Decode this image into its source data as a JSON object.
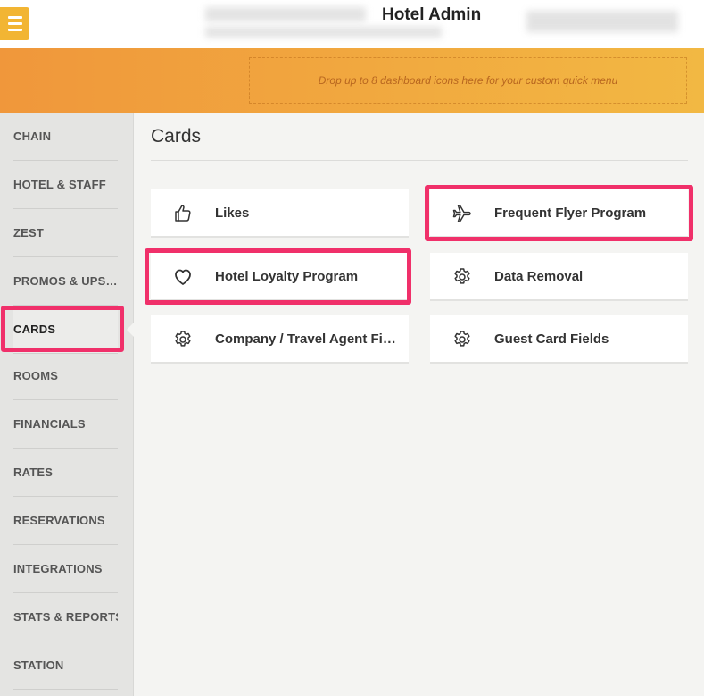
{
  "header": {
    "title": "Hotel Admin",
    "menu_icon": "hamburger-icon"
  },
  "quick_menu": {
    "placeholder": "Drop up to 8 dashboard icons here for your custom quick menu"
  },
  "sidebar": {
    "items": [
      {
        "label": "CHAIN"
      },
      {
        "label": "HOTEL & STAFF"
      },
      {
        "label": "ZEST"
      },
      {
        "label": "PROMOS & UPS…"
      },
      {
        "label": "CARDS",
        "active": true
      },
      {
        "label": "ROOMS"
      },
      {
        "label": "FINANCIALS"
      },
      {
        "label": "RATES"
      },
      {
        "label": "RESERVATIONS"
      },
      {
        "label": "INTEGRATIONS"
      },
      {
        "label": "STATS & REPORTS"
      },
      {
        "label": "STATION"
      }
    ]
  },
  "main": {
    "title": "Cards",
    "cards": [
      {
        "label": "Likes",
        "icon": "thumbs-up-icon"
      },
      {
        "label": "Frequent Flyer Program",
        "icon": "airplane-icon",
        "highlighted": true
      },
      {
        "label": "Hotel Loyalty Program",
        "icon": "heart-icon",
        "highlighted": true
      },
      {
        "label": "Data Removal",
        "icon": "gear-icon"
      },
      {
        "label": "Company / Travel Agent Fi…",
        "icon": "gear-icon"
      },
      {
        "label": "Guest Card Fields",
        "icon": "gear-icon"
      }
    ]
  },
  "colors": {
    "accent": "#f2b533",
    "band_start": "#f0973b",
    "band_end": "#f2b843",
    "highlight": "#f0306a"
  }
}
